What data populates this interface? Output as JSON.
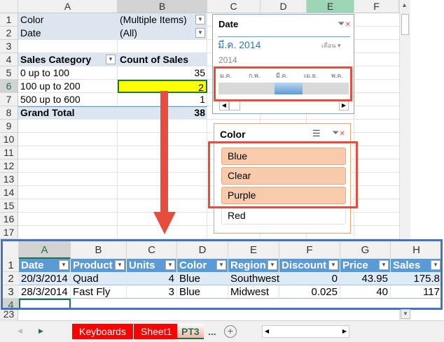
{
  "columns": [
    "A",
    "B",
    "C",
    "D",
    "E",
    "F"
  ],
  "rows": [
    "1",
    "2",
    "3",
    "4",
    "5",
    "6",
    "7",
    "8",
    "9",
    "10",
    "11",
    "12",
    "13",
    "14",
    "15",
    "16",
    "17"
  ],
  "pivot": {
    "filters": [
      {
        "label": "Color",
        "value": "(Multiple Items)"
      },
      {
        "label": "Date",
        "value": "(All)"
      }
    ],
    "header": {
      "category": "Sales Category",
      "count": "Count of Sales"
    },
    "rows": [
      {
        "category": "0 up to 100",
        "count": "35"
      },
      {
        "category": "100 up to 200",
        "count": "2"
      },
      {
        "category": "500 up to 600",
        "count": "1"
      }
    ],
    "total": {
      "label": "Grand Total",
      "count": "38"
    }
  },
  "date_slicer": {
    "title": "Date",
    "selection": "มี.ค. 2014",
    "level": "เดือน",
    "year": "2014",
    "months": [
      "ม.ค.",
      "ก.พ.",
      "มี.ค.",
      "เม.ย.",
      "พ.ค."
    ],
    "selected_index": 2
  },
  "color_slicer": {
    "title": "Color",
    "items": [
      {
        "label": "Blue",
        "selected": true
      },
      {
        "label": "Clear",
        "selected": true
      },
      {
        "label": "Purple",
        "selected": true
      },
      {
        "label": "Red",
        "selected": false
      }
    ]
  },
  "detail": {
    "columns": [
      "A",
      "B",
      "C",
      "D",
      "E",
      "F",
      "G",
      "H"
    ],
    "row_numbers": [
      "1",
      "2",
      "3",
      "4"
    ],
    "headers": [
      "Date",
      "Product",
      "Units",
      "Color",
      "Region",
      "Discount",
      "Price",
      "Sales"
    ],
    "rows": [
      [
        "20/3/2014",
        "Quad",
        "4",
        "Blue",
        "Southwest",
        "0",
        "43.95",
        "175.8"
      ],
      [
        "28/3/2014",
        "Fast Fly",
        "3",
        "Blue",
        "Midwest",
        "0.025",
        "40",
        "117"
      ]
    ],
    "below_row": "23"
  },
  "tabs": [
    {
      "label": "Keyboards"
    },
    {
      "label": "Sheet1"
    },
    {
      "label": "PT3",
      "active": true
    }
  ],
  "tabs_more": "...",
  "colors": {
    "accent_red": "#e84c3d",
    "selection_yellow": "#ffff00",
    "table_header": "#5b9bd5",
    "slicer_item": "#f8cbad"
  }
}
